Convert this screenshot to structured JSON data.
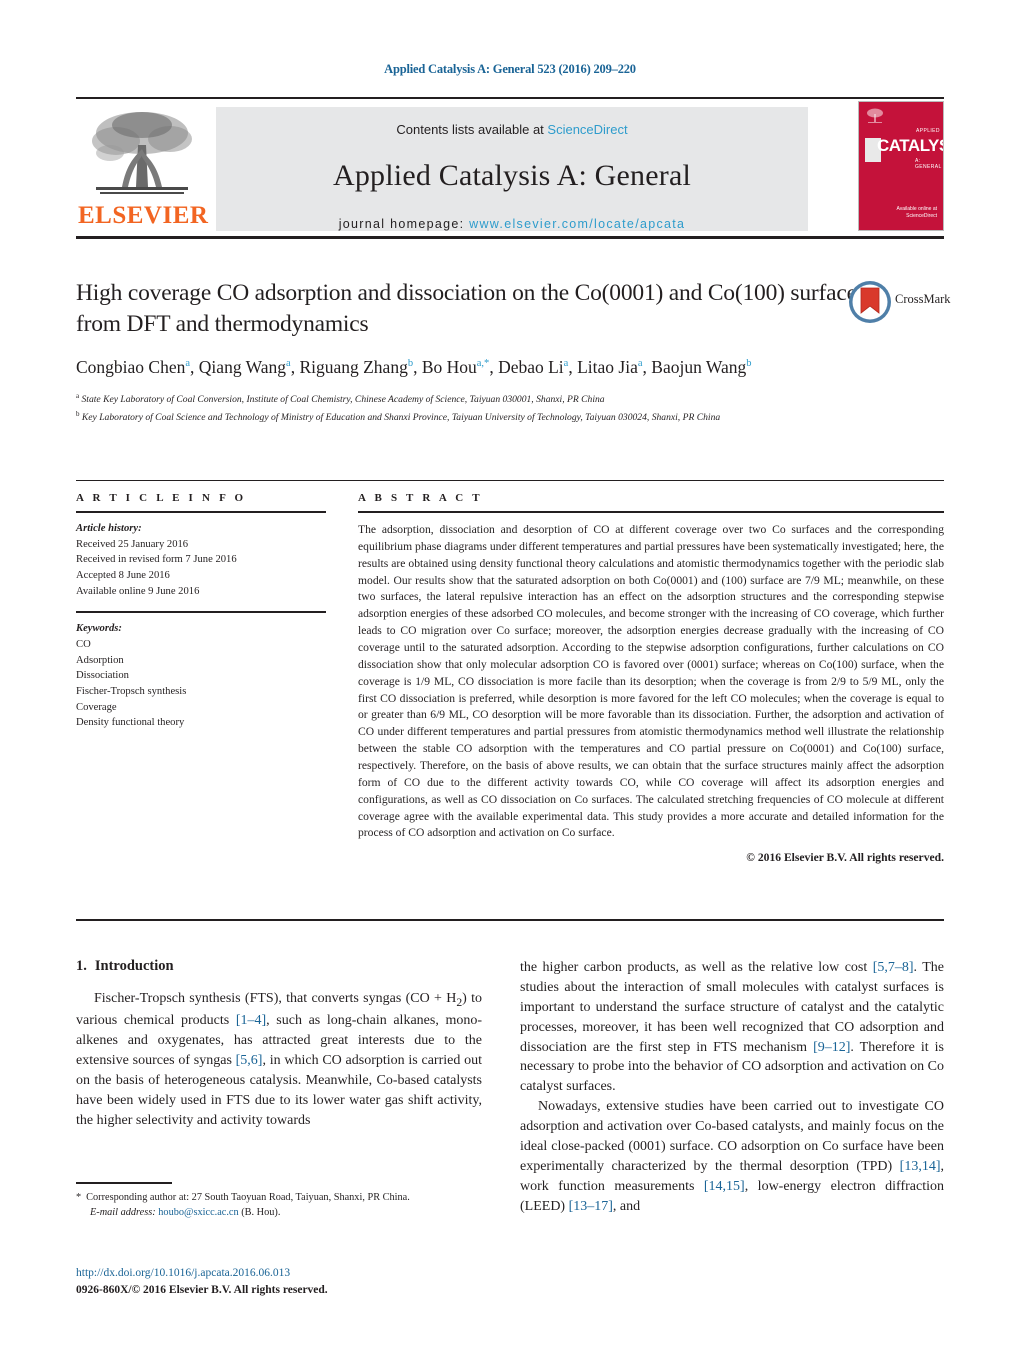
{
  "running_head": "Applied Catalysis A: General 523 (2016) 209–220",
  "masthead": {
    "contents_prefix": "Contents lists available at ",
    "sciencedirect": "ScienceDirect",
    "journal_title": "Applied Catalysis A: General",
    "homepage_prefix": "journal homepage: ",
    "homepage_url": "www.elsevier.com/locate/apcata",
    "publisher_wordmark": "ELSEVIER",
    "publisher_color": "#f26522",
    "link_color": "#2e9ccc",
    "cover": {
      "word": "CATALYSIS",
      "sub_top": "APPLIED",
      "sub_bottom": "A: GENERAL",
      "sciencedirect": "Available online at\\nScienceDirect",
      "background": "#c4123a"
    }
  },
  "title_block": {
    "title": "High coverage CO adsorption and dissociation on the Co(0001) and Co(100) surfaces from DFT and thermodynamics",
    "crossmark_label": "CrossMark",
    "authors": [
      {
        "name": "Congbiao Chen",
        "sup": "a",
        "sep": ", "
      },
      {
        "name": "Qiang Wang",
        "sup": "a",
        "sep": ", "
      },
      {
        "name": "Riguang Zhang",
        "sup": "b",
        "sep": ", "
      },
      {
        "name": "Bo Hou",
        "sup": "a,*",
        "sep": ", "
      },
      {
        "name": "Debao Li",
        "sup": "a",
        "sep": ", "
      },
      {
        "name": "Litao Jia",
        "sup": "a",
        "sep": ", "
      },
      {
        "name": "Baojun Wang",
        "sup": "b",
        "sep": ""
      }
    ],
    "affiliations": [
      {
        "sup": "a",
        "text": "State Key Laboratory of Coal Conversion, Institute of Coal Chemistry, Chinese Academy of Science, Taiyuan 030001, Shanxi, PR China"
      },
      {
        "sup": "b",
        "text": "Key Laboratory of Coal Science and Technology of Ministry of Education and Shanxi Province, Taiyuan University of Technology, Taiyuan 030024, Shanxi, PR China"
      }
    ]
  },
  "article_info": {
    "heading": "A R T I C L E  I N F O",
    "history_label": "Article history:",
    "history": [
      "Received 25 January 2016",
      "Received in revised form 7 June 2016",
      "Accepted 8 June 2016",
      "Available online 9 June 2016"
    ],
    "keywords_label": "Keywords:",
    "keywords": [
      "CO",
      "Adsorption",
      "Dissociation",
      "Fischer-Tropsch synthesis",
      "Coverage",
      "Density functional theory"
    ]
  },
  "abstract": {
    "heading": "A B S T R A C T",
    "text": "The adsorption, dissociation and desorption of CO at different coverage over two Co surfaces and the corresponding equilibrium phase diagrams under different temperatures and partial pressures have been systematically investigated; here, the results are obtained using density functional theory calculations and atomistic thermodynamics together with the periodic slab model. Our results show that the saturated adsorption on both Co(0001) and (100) surface are 7/9 ML; meanwhile, on these two surfaces, the lateral repulsive interaction has an effect on the adsorption structures and the corresponding stepwise adsorption energies of these adsorbed CO molecules, and become stronger with the increasing of CO coverage, which further leads to CO migration over Co surface; moreover, the adsorption energies decrease gradually with the increasing of CO coverage until to the saturated adsorption. According to the stepwise adsorption configurations, further calculations on CO dissociation show that only molecular adsorption CO is favored over (0001) surface; whereas on Co(100) surface, when the coverage is 1/9 ML, CO dissociation is more facile than its desorption; when the coverage is from 2/9 to 5/9 ML, only the first CO dissociation is preferred, while desorption is more favored for the left CO molecules; when the coverage is equal to or greater than 6/9 ML, CO desorption will be more favorable than its dissociation. Further, the adsorption and activation of CO under different temperatures and partial pressures from atomistic thermodynamics method well illustrate the relationship between the stable CO adsorption with the temperatures and CO partial pressure on Co(0001) and Co(100) surface, respectively. Therefore, on the basis of above results, we can obtain that the surface structures mainly affect the adsorption form of CO due to the different activity towards CO, while CO coverage will affect its adsorption energies and configurations, as well as CO dissociation on Co surfaces. The calculated stretching frequencies of CO molecule at different coverage agree with the available experimental data. This study provides a more accurate and detailed information for the process of CO adsorption and activation on Co surface.",
    "copyright": "© 2016 Elsevier B.V. All rights reserved."
  },
  "body": {
    "section_number": "1.",
    "section_title": "Introduction",
    "left_paragraph_1_pre": "Fischer-Tropsch synthesis (FTS), that converts syngas (CO + H",
    "left_paragraph_1_sub": "2",
    "left_paragraph_1_a": ") to various chemical products ",
    "ref_1_4": "[1–4]",
    "left_paragraph_1_b": ", such as long-chain alkanes, mono-alkenes and oxygenates, has attracted great interests due to the extensive sources of syngas ",
    "ref_5_6": "[5,6]",
    "left_paragraph_1_c": ", in which CO adsorption is carried out on the basis of heterogeneous catalysis. Meanwhile, Co-based catalysts have been widely used in FTS due to its lower water gas shift activity, the higher selectivity and activity towards",
    "right_paragraph_1_a": "the higher carbon products, as well as the relative low cost ",
    "ref_5_7_8": "[5,7–8]",
    "right_paragraph_1_b": ". The studies about the interaction of small molecules with catalyst surfaces is important to understand the surface structure of catalyst and the catalytic processes, moreover, it has been well recognized that CO adsorption and dissociation are the first step in FTS mechanism ",
    "ref_9_12": "[9–12]",
    "right_paragraph_1_c": ". Therefore it is necessary to probe into the behavior of CO adsorption and activation on Co catalyst surfaces.",
    "right_paragraph_2_a": "Nowadays, extensive studies have been carried out to investigate CO adsorption and activation over Co-based catalysts, and mainly focus on the ideal close-packed (0001) surface. CO adsorption on Co surface have been experimentally characterized by the thermal desorption (TPD) ",
    "ref_13_14": "[13,14]",
    "right_paragraph_2_b": ", work function measurements ",
    "ref_14_15": "[14,15]",
    "right_paragraph_2_c": ", low-energy electron diffraction (LEED) ",
    "ref_13_17": "[13–17]",
    "right_paragraph_2_d": ", and"
  },
  "footnotes": {
    "star": "*",
    "corresponding": "Corresponding author at: 27 South Taoyuan Road, Taiyuan, Shanxi, PR China.",
    "email_label": "E-mail address:",
    "email": "houbo@sxicc.ac.cn",
    "email_suffix": "(B. Hou).",
    "doi": "http://dx.doi.org/10.1016/j.apcata.2016.06.013",
    "issn": "0926-860X/© 2016 Elsevier B.V. All rights reserved."
  }
}
